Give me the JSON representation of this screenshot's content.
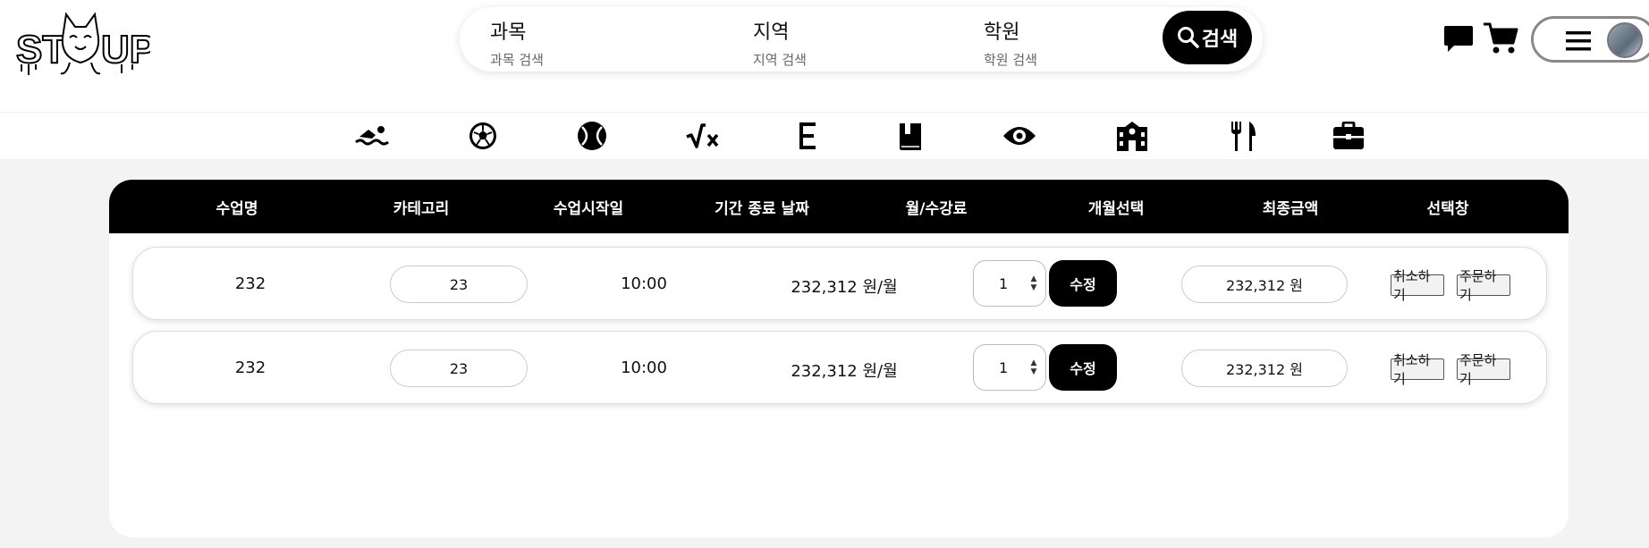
{
  "logo": {
    "text": "ST  UP"
  },
  "search": {
    "segments": [
      {
        "title": "과목",
        "sub": "과목 검색"
      },
      {
        "title": "지역",
        "sub": "지역 검색"
      },
      {
        "title": "학원",
        "sub": "학원 검색"
      }
    ],
    "button_label": "검색"
  },
  "categories": [
    "swimming-icon",
    "soccer-ball-icon",
    "baseball-icon",
    "math-sqrt-icon",
    "english-letter-icon",
    "book-icon",
    "eye-icon",
    "school-building-icon",
    "utensils-icon",
    "briefcase-icon"
  ],
  "table": {
    "headers": [
      "수업명",
      "카테고리",
      "수업시작일",
      "기간 종료 날짜",
      "월/수강료",
      "개월선택",
      "최종금액",
      "선택창"
    ],
    "rows": [
      {
        "name": "232",
        "category": "23",
        "start": "10:00",
        "fee": "232,312 원/월",
        "months": "1",
        "edit": "수정",
        "total": "232,312 원",
        "cancel": "취소하기",
        "order": "주문하기"
      },
      {
        "name": "232",
        "category": "23",
        "start": "10:00",
        "fee": "232,312 원/월",
        "months": "1",
        "edit": "수정",
        "total": "232,312 원",
        "cancel": "취소하기",
        "order": "주문하기"
      }
    ]
  }
}
